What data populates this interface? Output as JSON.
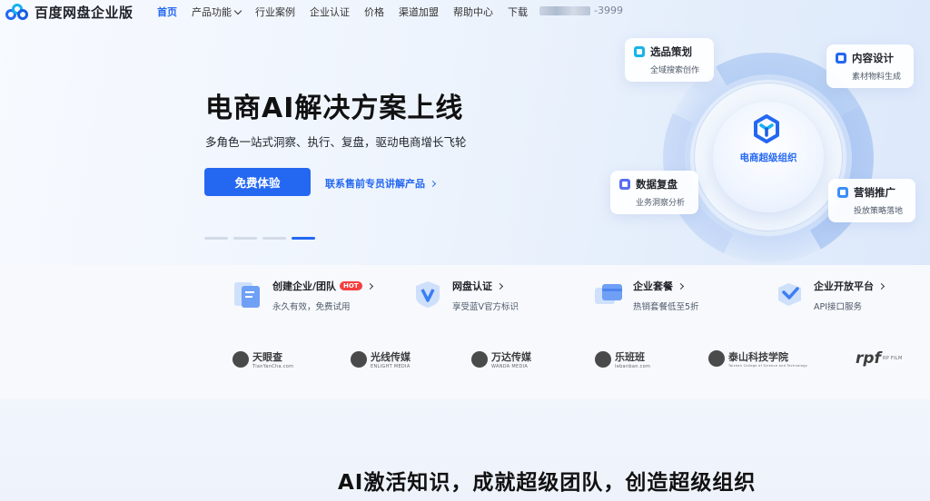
{
  "brand": {
    "name": "百度网盘企业版"
  },
  "nav": {
    "items": [
      {
        "label": "首页",
        "active": true
      },
      {
        "label": "产品功能",
        "dropdown": true
      },
      {
        "label": "行业案例"
      },
      {
        "label": "企业认证"
      },
      {
        "label": "价格"
      },
      {
        "label": "渠道加盟"
      },
      {
        "label": "帮助中心"
      },
      {
        "label": "下载"
      }
    ],
    "phone_suffix": "-3999"
  },
  "hero": {
    "title": "电商AI解决方案上线",
    "subtitle": "多角色一站式洞察、执行、复盘，驱动电商增长飞轮",
    "primary_button": "免费体验",
    "secondary_link": "联系售前专员讲解产品",
    "carousel": {
      "count": 4,
      "active_index": 3
    }
  },
  "graphic": {
    "center_label": "电商超级组织",
    "cards": [
      {
        "title": "选品策划",
        "subtitle": "全域搜索创作",
        "icon": "lightbulb-icon"
      },
      {
        "title": "内容设计",
        "subtitle": "素材物料生成",
        "icon": "image-icon"
      },
      {
        "title": "数据复盘",
        "subtitle": "业务洞察分析",
        "icon": "chart-icon"
      },
      {
        "title": "营销推广",
        "subtitle": "投放策略落地",
        "icon": "megaphone-icon"
      }
    ]
  },
  "features": [
    {
      "title": "创建企业/团队",
      "badge": "HOT",
      "subtitle": "永久有效，免费试用"
    },
    {
      "title": "网盘认证",
      "subtitle": "享受蓝V官方标识"
    },
    {
      "title": "企业套餐",
      "subtitle": "热销套餐低至5折"
    },
    {
      "title": "企业开放平台",
      "subtitle": "API接口服务"
    }
  ],
  "partners": [
    {
      "name": "天眼查",
      "sub": "TianYanCha.com"
    },
    {
      "name": "光线传媒",
      "sub": "ENLIGHT MEDIA"
    },
    {
      "name": "万达传媒",
      "sub": "WANDA MEDIA"
    },
    {
      "name": "乐班班",
      "sub": "lebanban.com"
    },
    {
      "name": "泰山科技学院",
      "sub": "Taishan College of Science and Technology"
    },
    {
      "name": "rpf",
      "sub": "RP FILM"
    }
  ],
  "bottom": {
    "title": "AI激活知识，成就超级团队，创造超级组织"
  },
  "colors": {
    "primary": "#2468f2",
    "hot": "#f53f3f"
  }
}
